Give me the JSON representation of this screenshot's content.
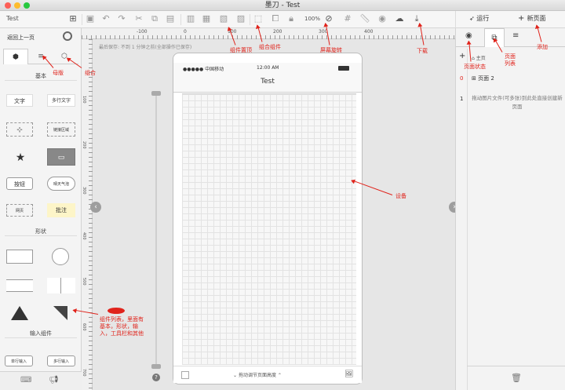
{
  "window": {
    "title": "墨刀 - Test",
    "project": "Test"
  },
  "toolbar": {
    "zoom": "100%",
    "run_label": "运行",
    "new_page_label": "新页面"
  },
  "left_panel": {
    "back_label": "返回上一页",
    "section_basic": "基本",
    "section_shapes": "形状",
    "section_inputs": "输入组件",
    "components": {
      "text": "文字",
      "multiline_text": "多行文字",
      "link_area": "链接区域",
      "button": "按钮",
      "weather": "晴天气泡",
      "webpage": "网页",
      "note": "批注",
      "single_input": "单行输入",
      "multi_input": "多行输入"
    }
  },
  "canvas": {
    "autosave_note": "最后保存: 不到 1 分钟之前(全部操作已保存)",
    "ruler_labels": [
      "-100",
      "0",
      "100",
      "200",
      "300",
      "400"
    ],
    "v_ruler_labels": [
      "100",
      "200",
      "300",
      "400",
      "500",
      "600",
      "700"
    ],
    "carrier": "●●●●● 中国移动",
    "time": "12:00 AM",
    "screen_title": "Test",
    "bottom_hint": "拖动调节页面高度"
  },
  "right_panel": {
    "home_label": "主页",
    "pages": [
      {
        "index": "0",
        "name": "页面 2"
      },
      {
        "index": "1",
        "name": "拖动图片文件(可多张)到此处直接创建新页面"
      }
    ]
  },
  "annotations": {
    "mother": "母版",
    "group": "组合",
    "comp_top": "组件置顶",
    "comp_group": "组合组件",
    "rotate": "屏幕旋转",
    "download": "下载",
    "add": "添加",
    "page_state": "页面状态",
    "page_list": "页面列表",
    "device": "设备",
    "comp_list": "组件列表，里面有基本，形状，输入，工具栏和其他"
  },
  "colors": {
    "annotation": "#e0231b",
    "accent": "#555555"
  }
}
